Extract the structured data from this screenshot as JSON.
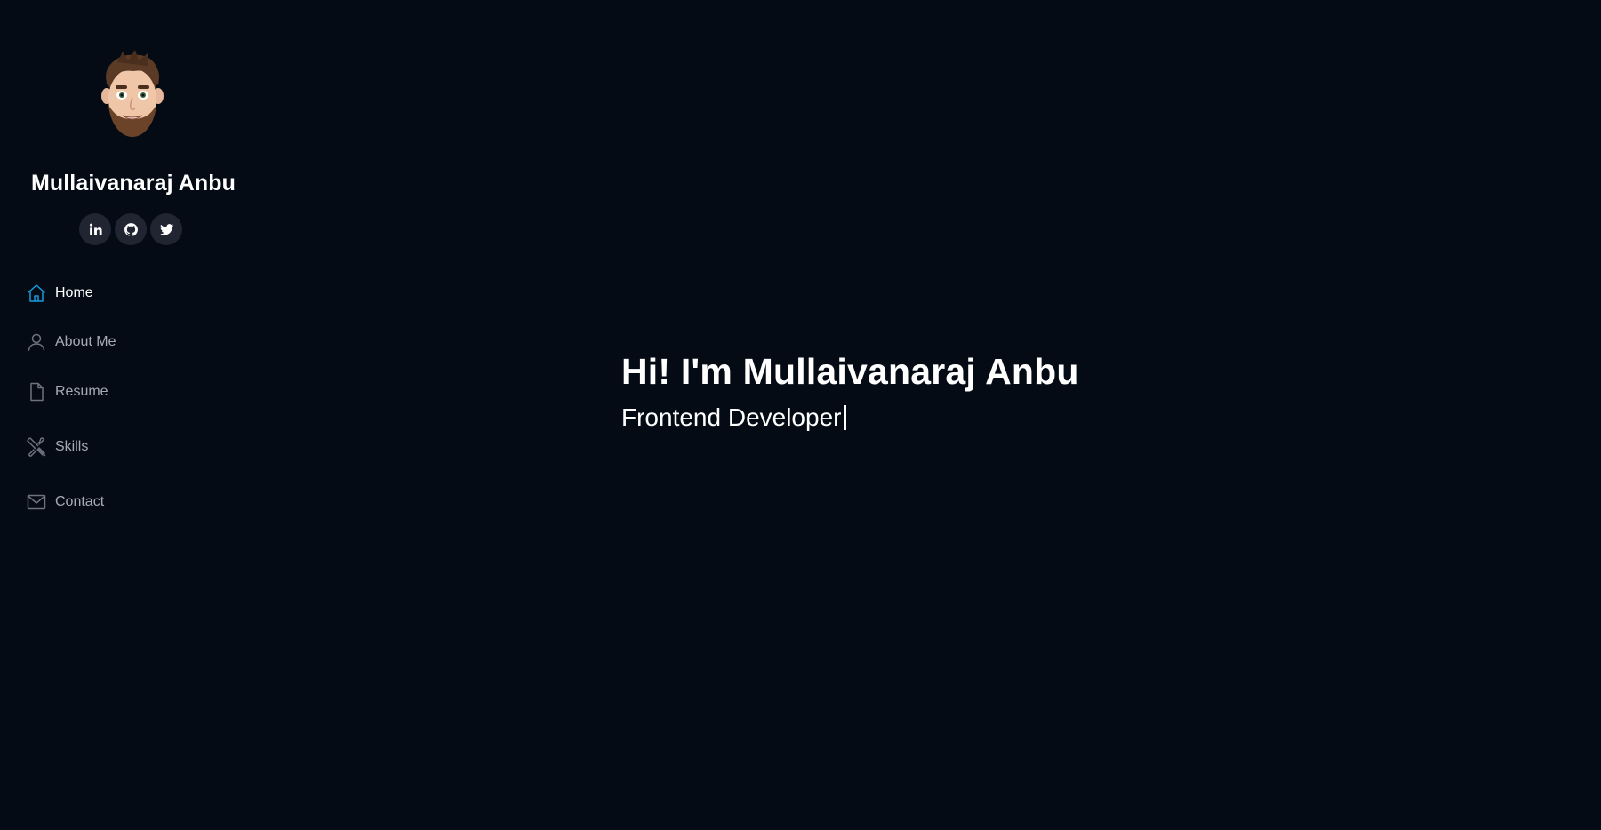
{
  "profile": {
    "name": "Mullaivanaraj Anbu",
    "avatar": "memoji-avatar"
  },
  "social": [
    {
      "name": "LinkedIn",
      "icon": "linkedin-icon"
    },
    {
      "name": "GitHub",
      "icon": "github-icon"
    },
    {
      "name": "Twitter",
      "icon": "twitter-icon"
    }
  ],
  "nav": {
    "items": [
      {
        "label": "Home",
        "icon": "home-icon",
        "active": true
      },
      {
        "label": "About Me",
        "icon": "person-icon",
        "active": false
      },
      {
        "label": "Resume",
        "icon": "file-icon",
        "active": false
      },
      {
        "label": "Skills",
        "icon": "tools-icon",
        "active": false
      },
      {
        "label": "Contact",
        "icon": "envelope-icon",
        "active": false
      }
    ]
  },
  "hero": {
    "title": "Hi! I'm Mullaivanaraj Anbu",
    "subtitle": "Frontend Developer"
  },
  "colors": {
    "background": "#040b14",
    "accent": "#149ddd",
    "nav_text": "#a8a9b4",
    "social_bg": "#212431"
  }
}
